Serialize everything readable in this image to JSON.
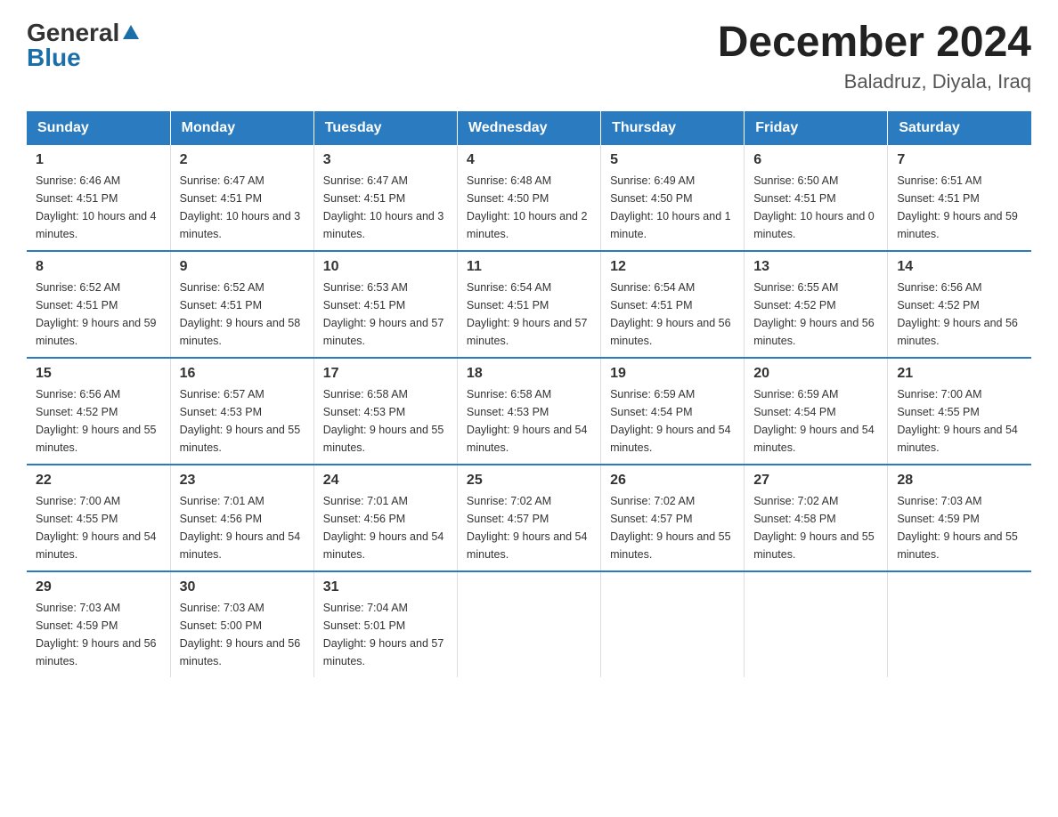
{
  "logo": {
    "text_general": "General",
    "triangle": "▶",
    "text_blue": "Blue"
  },
  "title": "December 2024",
  "location": "Baladruz, Diyala, Iraq",
  "headers": [
    "Sunday",
    "Monday",
    "Tuesday",
    "Wednesday",
    "Thursday",
    "Friday",
    "Saturday"
  ],
  "weeks": [
    [
      {
        "day": "1",
        "sunrise": "6:46 AM",
        "sunset": "4:51 PM",
        "daylight": "10 hours and 4 minutes."
      },
      {
        "day": "2",
        "sunrise": "6:47 AM",
        "sunset": "4:51 PM",
        "daylight": "10 hours and 3 minutes."
      },
      {
        "day": "3",
        "sunrise": "6:47 AM",
        "sunset": "4:51 PM",
        "daylight": "10 hours and 3 minutes."
      },
      {
        "day": "4",
        "sunrise": "6:48 AM",
        "sunset": "4:50 PM",
        "daylight": "10 hours and 2 minutes."
      },
      {
        "day": "5",
        "sunrise": "6:49 AM",
        "sunset": "4:50 PM",
        "daylight": "10 hours and 1 minute."
      },
      {
        "day": "6",
        "sunrise": "6:50 AM",
        "sunset": "4:51 PM",
        "daylight": "10 hours and 0 minutes."
      },
      {
        "day": "7",
        "sunrise": "6:51 AM",
        "sunset": "4:51 PM",
        "daylight": "9 hours and 59 minutes."
      }
    ],
    [
      {
        "day": "8",
        "sunrise": "6:52 AM",
        "sunset": "4:51 PM",
        "daylight": "9 hours and 59 minutes."
      },
      {
        "day": "9",
        "sunrise": "6:52 AM",
        "sunset": "4:51 PM",
        "daylight": "9 hours and 58 minutes."
      },
      {
        "day": "10",
        "sunrise": "6:53 AM",
        "sunset": "4:51 PM",
        "daylight": "9 hours and 57 minutes."
      },
      {
        "day": "11",
        "sunrise": "6:54 AM",
        "sunset": "4:51 PM",
        "daylight": "9 hours and 57 minutes."
      },
      {
        "day": "12",
        "sunrise": "6:54 AM",
        "sunset": "4:51 PM",
        "daylight": "9 hours and 56 minutes."
      },
      {
        "day": "13",
        "sunrise": "6:55 AM",
        "sunset": "4:52 PM",
        "daylight": "9 hours and 56 minutes."
      },
      {
        "day": "14",
        "sunrise": "6:56 AM",
        "sunset": "4:52 PM",
        "daylight": "9 hours and 56 minutes."
      }
    ],
    [
      {
        "day": "15",
        "sunrise": "6:56 AM",
        "sunset": "4:52 PM",
        "daylight": "9 hours and 55 minutes."
      },
      {
        "day": "16",
        "sunrise": "6:57 AM",
        "sunset": "4:53 PM",
        "daylight": "9 hours and 55 minutes."
      },
      {
        "day": "17",
        "sunrise": "6:58 AM",
        "sunset": "4:53 PM",
        "daylight": "9 hours and 55 minutes."
      },
      {
        "day": "18",
        "sunrise": "6:58 AM",
        "sunset": "4:53 PM",
        "daylight": "9 hours and 54 minutes."
      },
      {
        "day": "19",
        "sunrise": "6:59 AM",
        "sunset": "4:54 PM",
        "daylight": "9 hours and 54 minutes."
      },
      {
        "day": "20",
        "sunrise": "6:59 AM",
        "sunset": "4:54 PM",
        "daylight": "9 hours and 54 minutes."
      },
      {
        "day": "21",
        "sunrise": "7:00 AM",
        "sunset": "4:55 PM",
        "daylight": "9 hours and 54 minutes."
      }
    ],
    [
      {
        "day": "22",
        "sunrise": "7:00 AM",
        "sunset": "4:55 PM",
        "daylight": "9 hours and 54 minutes."
      },
      {
        "day": "23",
        "sunrise": "7:01 AM",
        "sunset": "4:56 PM",
        "daylight": "9 hours and 54 minutes."
      },
      {
        "day": "24",
        "sunrise": "7:01 AM",
        "sunset": "4:56 PM",
        "daylight": "9 hours and 54 minutes."
      },
      {
        "day": "25",
        "sunrise": "7:02 AM",
        "sunset": "4:57 PM",
        "daylight": "9 hours and 54 minutes."
      },
      {
        "day": "26",
        "sunrise": "7:02 AM",
        "sunset": "4:57 PM",
        "daylight": "9 hours and 55 minutes."
      },
      {
        "day": "27",
        "sunrise": "7:02 AM",
        "sunset": "4:58 PM",
        "daylight": "9 hours and 55 minutes."
      },
      {
        "day": "28",
        "sunrise": "7:03 AM",
        "sunset": "4:59 PM",
        "daylight": "9 hours and 55 minutes."
      }
    ],
    [
      {
        "day": "29",
        "sunrise": "7:03 AM",
        "sunset": "4:59 PM",
        "daylight": "9 hours and 56 minutes."
      },
      {
        "day": "30",
        "sunrise": "7:03 AM",
        "sunset": "5:00 PM",
        "daylight": "9 hours and 56 minutes."
      },
      {
        "day": "31",
        "sunrise": "7:04 AM",
        "sunset": "5:01 PM",
        "daylight": "9 hours and 57 minutes."
      },
      {
        "day": "",
        "sunrise": "",
        "sunset": "",
        "daylight": ""
      },
      {
        "day": "",
        "sunrise": "",
        "sunset": "",
        "daylight": ""
      },
      {
        "day": "",
        "sunrise": "",
        "sunset": "",
        "daylight": ""
      },
      {
        "day": "",
        "sunrise": "",
        "sunset": "",
        "daylight": ""
      }
    ]
  ]
}
